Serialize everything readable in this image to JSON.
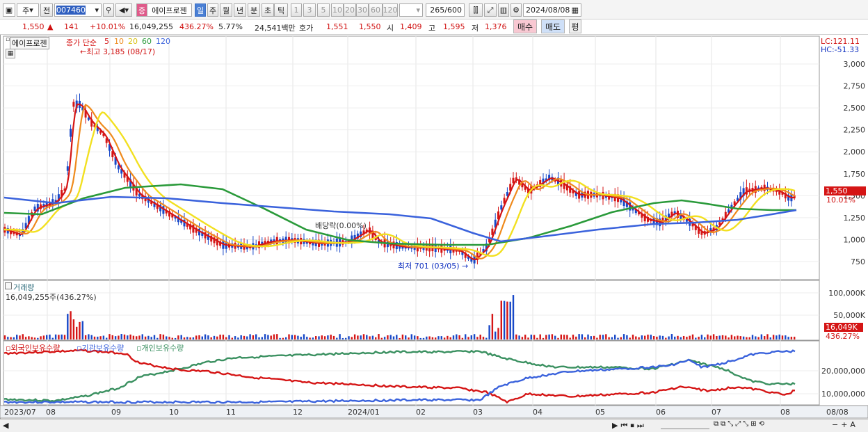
{
  "toolbar": {
    "market": "주",
    "prev": "전",
    "code": "007460",
    "name": "에이프로젠",
    "kind_icon": "증",
    "periods": [
      "일",
      "주",
      "월",
      "년",
      "분",
      "초",
      "틱"
    ],
    "nums": [
      "1",
      "3",
      "5",
      "10",
      "20",
      "30",
      "60",
      "120"
    ],
    "count": "265",
    "count_total": "/600",
    "date": "2024/08/08"
  },
  "quote": {
    "price": "1,550",
    "change": "141",
    "pct": "+10.01%",
    "volume": "16,049,255",
    "vol_pct": "436.27%",
    "turnover": "5.77%",
    "amount": "24,541백만",
    "ask_label": "호가",
    "ask": "1,551",
    "bid": "1,550",
    "open_label": "시",
    "open": "1,409",
    "high_label": "고",
    "high": "1,595",
    "low_label": "저",
    "low": "1,376",
    "buy": "매수",
    "sell": "매도",
    "avg": "평"
  },
  "price_panel": {
    "title": "에이프로젠",
    "ma_label": "종가 단순",
    "ma": [
      "5",
      "10",
      "20",
      "60",
      "120"
    ],
    "lc": "LC:121.11",
    "hc": "HC:-51.33",
    "high_note": "최고 3,185 (08/17)",
    "low_note": "최저 701 (03/05)",
    "div_note": "배당락(0.00%)",
    "cur_price": "1,550",
    "cur_pct": "10.01%",
    "y_ticks": [
      "3,000",
      "2,750",
      "2,500",
      "2,250",
      "2,000",
      "1,750",
      "1,500",
      "1,250",
      "1,000",
      "750"
    ]
  },
  "volume_panel": {
    "title": "거래량",
    "value": "16,049,255주(436.27%)",
    "y_ticks": [
      "100,000K",
      "50,000K"
    ],
    "cur": "16,049K",
    "cur_pct": "436.27%"
  },
  "holdings_panel": {
    "legend": [
      "외국인보유수량",
      "기관보유수량",
      "개인보유수량"
    ],
    "y_ticks": [
      "20,000,000",
      "10,000,000"
    ]
  },
  "x_axis": [
    "2023/07",
    "08",
    "09",
    "10",
    "11",
    "12",
    "2024/01",
    "02",
    "03",
    "04",
    "05",
    "06",
    "07",
    "08",
    "08/08"
  ],
  "colors": {
    "up": "#d51515",
    "down": "#1848c8",
    "ma5": "#d51515",
    "ma10": "#ef8a1c",
    "ma20": "#f2e020",
    "ma60": "#2a9a3a",
    "ma120": "#3a62dc",
    "foreign": "#d51515",
    "inst": "#3a62dc",
    "indiv": "#3a9060"
  }
}
